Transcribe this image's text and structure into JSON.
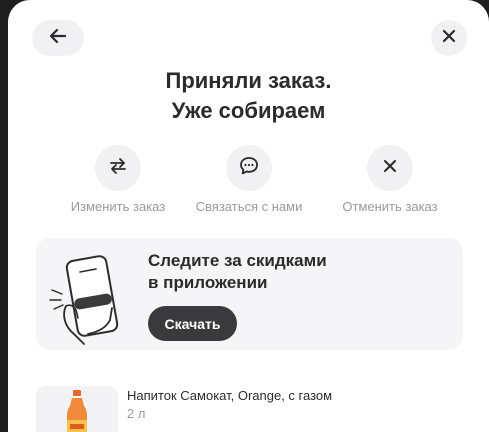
{
  "header": {
    "back_icon": "arrow-left-icon",
    "close_icon": "close-icon"
  },
  "title": {
    "line1": "Приняли заказ.",
    "line2": "Уже собираем"
  },
  "actions": [
    {
      "label": "Изменить заказ",
      "icon": "swap-arrows-icon"
    },
    {
      "label": "Связаться с нами",
      "icon": "chat-bubble-icon"
    },
    {
      "label": "Отменить заказ",
      "icon": "close-icon"
    }
  ],
  "promo": {
    "line1": "Следите за скидками",
    "line2": "в приложении",
    "button_label": "Скачать",
    "illustration": "hand-holding-phone-illustration"
  },
  "product": {
    "name": "Напиток Самокат, Orange, с газом",
    "volume": "2 л",
    "thumbnail": "soda-bottle-image"
  },
  "colors": {
    "button_bg": "#f1f1f3",
    "dark_button": "#3a3a3c",
    "muted_text": "#9a9a9f",
    "primary_text": "#2b2b2b",
    "backdrop": "#1e1e1e"
  }
}
